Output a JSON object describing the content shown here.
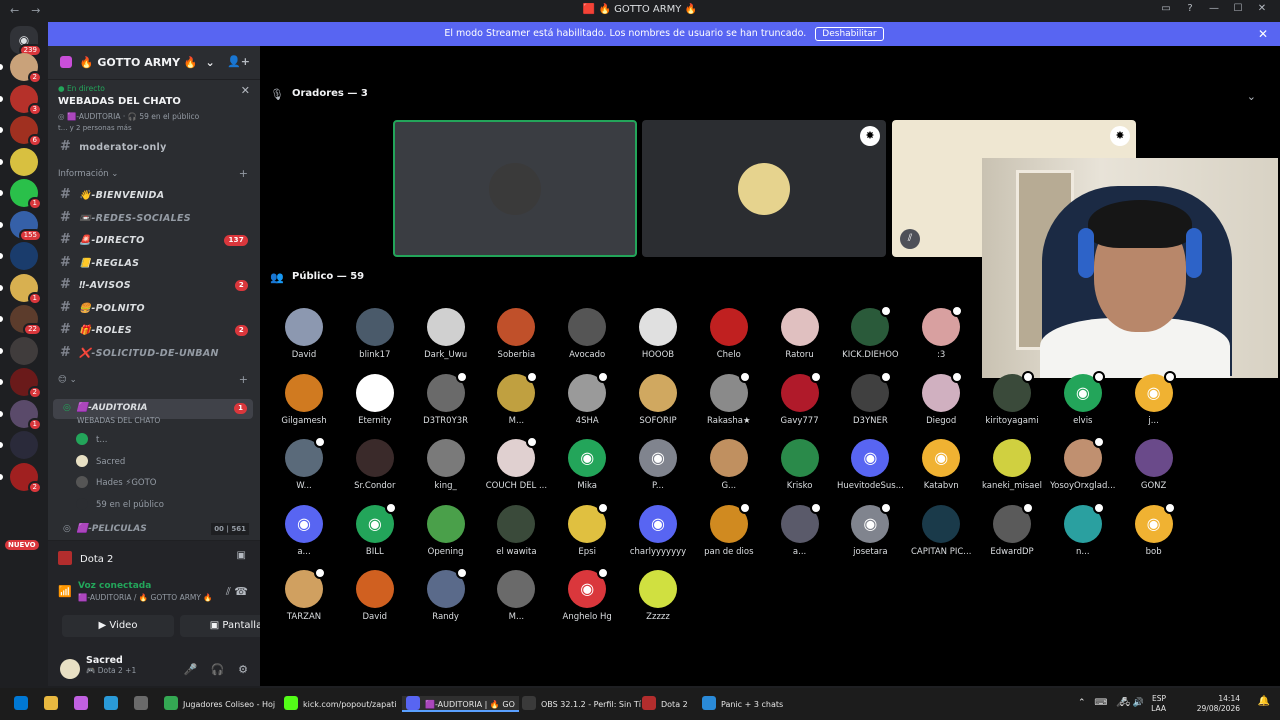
{
  "titlebar": {
    "title": "🟥 🔥 GOTTO ARMY 🔥"
  },
  "banner": {
    "text": "El modo Streamer está habilitado. Los nombres de usuario se han truncado.",
    "button": "Deshabilitar"
  },
  "guilds": {
    "home_badge": "239",
    "items": [
      {
        "color": "#c9a27a",
        "badge": "2"
      },
      {
        "color": "#b5312a",
        "badge": "3"
      },
      {
        "color": "#a03020",
        "badge": "6"
      },
      {
        "color": "#d8c040",
        "badge": ""
      },
      {
        "color": "#2ac04a",
        "badge": "1"
      },
      {
        "color": "#3560a8",
        "badge": "155"
      },
      {
        "color": "#1a3c6c",
        "badge": ""
      },
      {
        "color": "#d8b050",
        "badge": "1"
      },
      {
        "color": "#5c3c2c",
        "badge": "22"
      },
      {
        "color": "#403c3c",
        "badge": ""
      },
      {
        "color": "#6a1a1a",
        "badge": "2"
      },
      {
        "color": "#5a4a6a",
        "badge": "1"
      },
      {
        "color": "#2a2a3a",
        "badge": ""
      },
      {
        "color": "#a02020",
        "badge": "2"
      }
    ],
    "new_label": "NUEVO"
  },
  "server": {
    "name": "🔥 GOTTO ARMY 🔥"
  },
  "live": {
    "status": "En directo",
    "title": "WEBADAS DEL CHATO",
    "channel": "🟪-AUDITORIA",
    "audience": "🎧 59 en el público",
    "people": "t... y 2 personas más",
    "clipped": "moderator-only"
  },
  "category_info": "Información",
  "channels": [
    {
      "emoji": "👋",
      "name": "-BIENVENIDA",
      "count": "",
      "bright": true
    },
    {
      "emoji": "📼",
      "name": "-REDES-SOCIALES",
      "count": "",
      "bright": false
    },
    {
      "emoji": "🚨",
      "name": "-DIRECTO",
      "count": "137",
      "bright": true
    },
    {
      "emoji": "📒",
      "name": "-REGLAS",
      "count": "",
      "bright": true
    },
    {
      "emoji": "‼",
      "name": "-AVISOS",
      "count": "2",
      "bright": true
    },
    {
      "emoji": "🍔",
      "name": "-POLNITO",
      "count": "",
      "bright": true
    },
    {
      "emoji": "🎁",
      "name": "-ROLES",
      "count": "2",
      "bright": true
    },
    {
      "emoji": "❌",
      "name": "-SOLICITUD-DE-UNBAN",
      "count": "",
      "bright": false
    }
  ],
  "category2": "😊",
  "voice_channel": {
    "name": "🟪-AUDITORIA",
    "count": "1",
    "topic": "WEBADAS DEL CHATO"
  },
  "voice_members": [
    {
      "name": "t...",
      "color": "#23a55a"
    },
    {
      "name": "Sacred",
      "color": "#e8e0c4"
    },
    {
      "name": "Hades ⚡GOTO",
      "color": "#555"
    },
    {
      "name": "59 en el público",
      "color": "#2b2d31"
    }
  ],
  "peliculas": {
    "name": "🟪-PELICULAS",
    "a": "00",
    "b": "561"
  },
  "game": {
    "name": "Dota 2"
  },
  "voice": {
    "status": "Voz conectada",
    "sub": "🟪-AUDITORIA / 🔥 GOTTO ARMY 🔥",
    "video": "Video",
    "screen": "Pantalla"
  },
  "user": {
    "name": "Sacred",
    "status": "🎮 Dota 2 +1"
  },
  "stage": {
    "speakers": "Oradores — 3",
    "audience": "Público — 59"
  },
  "speakers": [
    {
      "color": "#3a3a3a",
      "mod": false,
      "muted": false
    },
    {
      "color": "#e6d38e",
      "mod": true,
      "muted": false
    },
    {
      "color": "#efe7d2",
      "mod": true,
      "muted": true
    }
  ],
  "audience_members": [
    {
      "name": "David",
      "color": "#8c98b0",
      "mod": false,
      "discord": false
    },
    {
      "name": "blink17",
      "color": "#4a5a6a",
      "mod": false,
      "discord": false
    },
    {
      "name": "Dark_Uwu",
      "color": "#d0d0d0",
      "mod": false,
      "discord": false
    },
    {
      "name": "Soberbia",
      "color": "#c0502a",
      "mod": false,
      "discord": false
    },
    {
      "name": "Avocado",
      "color": "#555",
      "mod": false,
      "discord": false
    },
    {
      "name": "HOOOB",
      "color": "#e0e0e0",
      "mod": false,
      "discord": false
    },
    {
      "name": "Chelo",
      "color": "#c02020",
      "mod": false,
      "discord": false
    },
    {
      "name": "Ratoru",
      "color": "#e0c0c0",
      "mod": false,
      "discord": false
    },
    {
      "name": "KICK.DIEHOO",
      "color": "#2a5a3a",
      "mod": true,
      "discord": false
    },
    {
      "name": ":3",
      "color": "#d8a0a0",
      "mod": true,
      "discord": false
    },
    {
      "name": "",
      "color": "#000",
      "mod": false,
      "discord": false
    },
    {
      "name": "",
      "color": "#000",
      "mod": false,
      "discord": false
    },
    {
      "name": "",
      "color": "#000",
      "mod": false,
      "discord": false
    },
    {
      "name": "Gilgamesh",
      "color": "#d07a20",
      "mod": false,
      "discord": false
    },
    {
      "name": "Eternity",
      "color": "#ffffff",
      "mod": false,
      "discord": true
    },
    {
      "name": "D3TR0Y3R",
      "color": "#6a6a6a",
      "mod": true,
      "discord": false
    },
    {
      "name": "M...",
      "color": "#c0a040",
      "mod": true,
      "discord": false
    },
    {
      "name": "4SHA",
      "color": "#9a9a9a",
      "mod": true,
      "discord": false
    },
    {
      "name": "SOFORIP",
      "color": "#d0a860",
      "mod": false,
      "discord": false
    },
    {
      "name": "Rakasha★",
      "color": "#8a8a8a",
      "mod": true,
      "discord": false
    },
    {
      "name": "Gavy777",
      "color": "#b01a2a",
      "mod": true,
      "discord": false
    },
    {
      "name": "D3YNER",
      "color": "#404040",
      "mod": true,
      "discord": false
    },
    {
      "name": "Diegod",
      "color": "#d0b0c0",
      "mod": true,
      "discord": false
    },
    {
      "name": "kiritoyagami",
      "color": "#3a4a3a",
      "mod": true,
      "discord": false
    },
    {
      "name": "elvis",
      "color": "#23a55a",
      "mod": true,
      "discord": true
    },
    {
      "name": "j...",
      "color": "#f0b232",
      "mod": true,
      "discord": true
    },
    {
      "name": "W...",
      "color": "#5a6a7a",
      "mod": true,
      "discord": false
    },
    {
      "name": "Sr.Condor",
      "color": "#3a2a2a",
      "mod": false,
      "discord": false
    },
    {
      "name": "king_",
      "color": "#7a7a7a",
      "mod": false,
      "discord": false
    },
    {
      "name": "COUCH DEL ...",
      "color": "#e0d0d0",
      "mod": true,
      "discord": false
    },
    {
      "name": "Mika",
      "color": "#23a55a",
      "mod": false,
      "discord": true
    },
    {
      "name": "P...",
      "color": "#80848e",
      "mod": false,
      "discord": true
    },
    {
      "name": "G...",
      "color": "#c09060",
      "mod": false,
      "discord": false
    },
    {
      "name": "Krisko",
      "color": "#2a8a4a",
      "mod": false,
      "discord": false
    },
    {
      "name": "HuevitodeSus...",
      "color": "#5865f2",
      "mod": false,
      "discord": true
    },
    {
      "name": "Katabvn",
      "color": "#f0b232",
      "mod": false,
      "discord": true
    },
    {
      "name": "kaneki_misael",
      "color": "#d0d040",
      "mod": false,
      "discord": false
    },
    {
      "name": "YosoyOrxglad...",
      "color": "#c09070",
      "mod": true,
      "discord": false
    },
    {
      "name": "GONZ",
      "color": "#6a4a8a",
      "mod": false,
      "discord": false
    },
    {
      "name": "a...",
      "color": "#5865f2",
      "mod": false,
      "discord": true
    },
    {
      "name": "BILL",
      "color": "#23a55a",
      "mod": true,
      "discord": true
    },
    {
      "name": "Opening",
      "color": "#4aa04a",
      "mod": false,
      "discord": false
    },
    {
      "name": "el wawita",
      "color": "#3a4a3a",
      "mod": false,
      "discord": false
    },
    {
      "name": "Epsi",
      "color": "#e0c040",
      "mod": true,
      "discord": false
    },
    {
      "name": "charlyyyyyyy",
      "color": "#5865f2",
      "mod": false,
      "discord": true
    },
    {
      "name": "pan de dios",
      "color": "#d08a20",
      "mod": true,
      "discord": false
    },
    {
      "name": "a...",
      "color": "#5a5a6a",
      "mod": true,
      "discord": false
    },
    {
      "name": "josetara",
      "color": "#80848e",
      "mod": true,
      "discord": true
    },
    {
      "name": "CAPITAN PIC...",
      "color": "#1a3a4a",
      "mod": false,
      "discord": false
    },
    {
      "name": "EdwardDP",
      "color": "#5a5a5a",
      "mod": true,
      "discord": false
    },
    {
      "name": "n...",
      "color": "#2aa0a0",
      "mod": true,
      "discord": false
    },
    {
      "name": "bob",
      "color": "#f0b232",
      "mod": true,
      "discord": true
    },
    {
      "name": "TARZÁN",
      "color": "#d0a060",
      "mod": true,
      "discord": false
    },
    {
      "name": "David",
      "color": "#d06020",
      "mod": false,
      "discord": false
    },
    {
      "name": "Randy",
      "color": "#5a6a8a",
      "mod": true,
      "discord": false
    },
    {
      "name": "M...",
      "color": "#6a6a6a",
      "mod": false,
      "discord": false
    },
    {
      "name": "Anghelo Hg",
      "color": "#da373c",
      "mod": true,
      "discord": true
    },
    {
      "name": "Zzzzz",
      "color": "#d0e040",
      "mod": false,
      "discord": false
    }
  ],
  "taskbar": [
    {
      "label": "",
      "color": "#0078d4"
    },
    {
      "label": "",
      "color": "#e8b840"
    },
    {
      "label": "",
      "color": "#c060e0"
    },
    {
      "label": "",
      "color": "#2a9ad8"
    },
    {
      "label": "",
      "color": "#6a6a6a"
    },
    {
      "label": "Jugadores Coliseo - Hoj",
      "color": "#34a853"
    },
    {
      "label": "kick.com/popout/zapati",
      "color": "#53fc18"
    },
    {
      "label": "🟪-AUDITORIA | 🔥 GO",
      "color": "#5865f2"
    },
    {
      "label": "OBS 32.1.2 - Perfil: Sin Tí",
      "color": "#3a3a3a"
    },
    {
      "label": "Dota 2",
      "color": "#b22d2d"
    },
    {
      "label": "Panic + 3 chats",
      "color": "#2a8ad8"
    }
  ],
  "tray": {
    "lang1": "ESP",
    "lang2": "LAA",
    "time": "14:14",
    "date": "29/08/2026"
  }
}
